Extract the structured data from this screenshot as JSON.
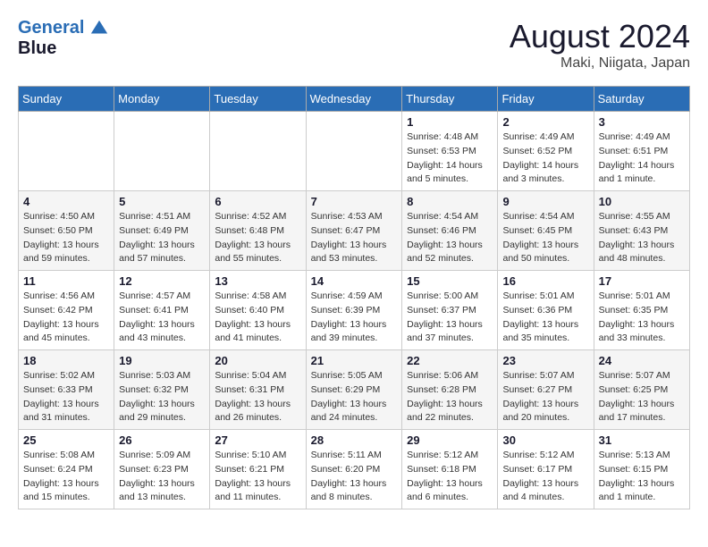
{
  "logo": {
    "line1": "General",
    "line2": "Blue"
  },
  "title": "August 2024",
  "location": "Maki, Niigata, Japan",
  "days_of_week": [
    "Sunday",
    "Monday",
    "Tuesday",
    "Wednesday",
    "Thursday",
    "Friday",
    "Saturday"
  ],
  "weeks": [
    [
      {
        "num": "",
        "info": ""
      },
      {
        "num": "",
        "info": ""
      },
      {
        "num": "",
        "info": ""
      },
      {
        "num": "",
        "info": ""
      },
      {
        "num": "1",
        "info": "Sunrise: 4:48 AM\nSunset: 6:53 PM\nDaylight: 14 hours\nand 5 minutes."
      },
      {
        "num": "2",
        "info": "Sunrise: 4:49 AM\nSunset: 6:52 PM\nDaylight: 14 hours\nand 3 minutes."
      },
      {
        "num": "3",
        "info": "Sunrise: 4:49 AM\nSunset: 6:51 PM\nDaylight: 14 hours\nand 1 minute."
      }
    ],
    [
      {
        "num": "4",
        "info": "Sunrise: 4:50 AM\nSunset: 6:50 PM\nDaylight: 13 hours\nand 59 minutes."
      },
      {
        "num": "5",
        "info": "Sunrise: 4:51 AM\nSunset: 6:49 PM\nDaylight: 13 hours\nand 57 minutes."
      },
      {
        "num": "6",
        "info": "Sunrise: 4:52 AM\nSunset: 6:48 PM\nDaylight: 13 hours\nand 55 minutes."
      },
      {
        "num": "7",
        "info": "Sunrise: 4:53 AM\nSunset: 6:47 PM\nDaylight: 13 hours\nand 53 minutes."
      },
      {
        "num": "8",
        "info": "Sunrise: 4:54 AM\nSunset: 6:46 PM\nDaylight: 13 hours\nand 52 minutes."
      },
      {
        "num": "9",
        "info": "Sunrise: 4:54 AM\nSunset: 6:45 PM\nDaylight: 13 hours\nand 50 minutes."
      },
      {
        "num": "10",
        "info": "Sunrise: 4:55 AM\nSunset: 6:43 PM\nDaylight: 13 hours\nand 48 minutes."
      }
    ],
    [
      {
        "num": "11",
        "info": "Sunrise: 4:56 AM\nSunset: 6:42 PM\nDaylight: 13 hours\nand 45 minutes."
      },
      {
        "num": "12",
        "info": "Sunrise: 4:57 AM\nSunset: 6:41 PM\nDaylight: 13 hours\nand 43 minutes."
      },
      {
        "num": "13",
        "info": "Sunrise: 4:58 AM\nSunset: 6:40 PM\nDaylight: 13 hours\nand 41 minutes."
      },
      {
        "num": "14",
        "info": "Sunrise: 4:59 AM\nSunset: 6:39 PM\nDaylight: 13 hours\nand 39 minutes."
      },
      {
        "num": "15",
        "info": "Sunrise: 5:00 AM\nSunset: 6:37 PM\nDaylight: 13 hours\nand 37 minutes."
      },
      {
        "num": "16",
        "info": "Sunrise: 5:01 AM\nSunset: 6:36 PM\nDaylight: 13 hours\nand 35 minutes."
      },
      {
        "num": "17",
        "info": "Sunrise: 5:01 AM\nSunset: 6:35 PM\nDaylight: 13 hours\nand 33 minutes."
      }
    ],
    [
      {
        "num": "18",
        "info": "Sunrise: 5:02 AM\nSunset: 6:33 PM\nDaylight: 13 hours\nand 31 minutes."
      },
      {
        "num": "19",
        "info": "Sunrise: 5:03 AM\nSunset: 6:32 PM\nDaylight: 13 hours\nand 29 minutes."
      },
      {
        "num": "20",
        "info": "Sunrise: 5:04 AM\nSunset: 6:31 PM\nDaylight: 13 hours\nand 26 minutes."
      },
      {
        "num": "21",
        "info": "Sunrise: 5:05 AM\nSunset: 6:29 PM\nDaylight: 13 hours\nand 24 minutes."
      },
      {
        "num": "22",
        "info": "Sunrise: 5:06 AM\nSunset: 6:28 PM\nDaylight: 13 hours\nand 22 minutes."
      },
      {
        "num": "23",
        "info": "Sunrise: 5:07 AM\nSunset: 6:27 PM\nDaylight: 13 hours\nand 20 minutes."
      },
      {
        "num": "24",
        "info": "Sunrise: 5:07 AM\nSunset: 6:25 PM\nDaylight: 13 hours\nand 17 minutes."
      }
    ],
    [
      {
        "num": "25",
        "info": "Sunrise: 5:08 AM\nSunset: 6:24 PM\nDaylight: 13 hours\nand 15 minutes."
      },
      {
        "num": "26",
        "info": "Sunrise: 5:09 AM\nSunset: 6:23 PM\nDaylight: 13 hours\nand 13 minutes."
      },
      {
        "num": "27",
        "info": "Sunrise: 5:10 AM\nSunset: 6:21 PM\nDaylight: 13 hours\nand 11 minutes."
      },
      {
        "num": "28",
        "info": "Sunrise: 5:11 AM\nSunset: 6:20 PM\nDaylight: 13 hours\nand 8 minutes."
      },
      {
        "num": "29",
        "info": "Sunrise: 5:12 AM\nSunset: 6:18 PM\nDaylight: 13 hours\nand 6 minutes."
      },
      {
        "num": "30",
        "info": "Sunrise: 5:12 AM\nSunset: 6:17 PM\nDaylight: 13 hours\nand 4 minutes."
      },
      {
        "num": "31",
        "info": "Sunrise: 5:13 AM\nSunset: 6:15 PM\nDaylight: 13 hours\nand 1 minute."
      }
    ]
  ]
}
